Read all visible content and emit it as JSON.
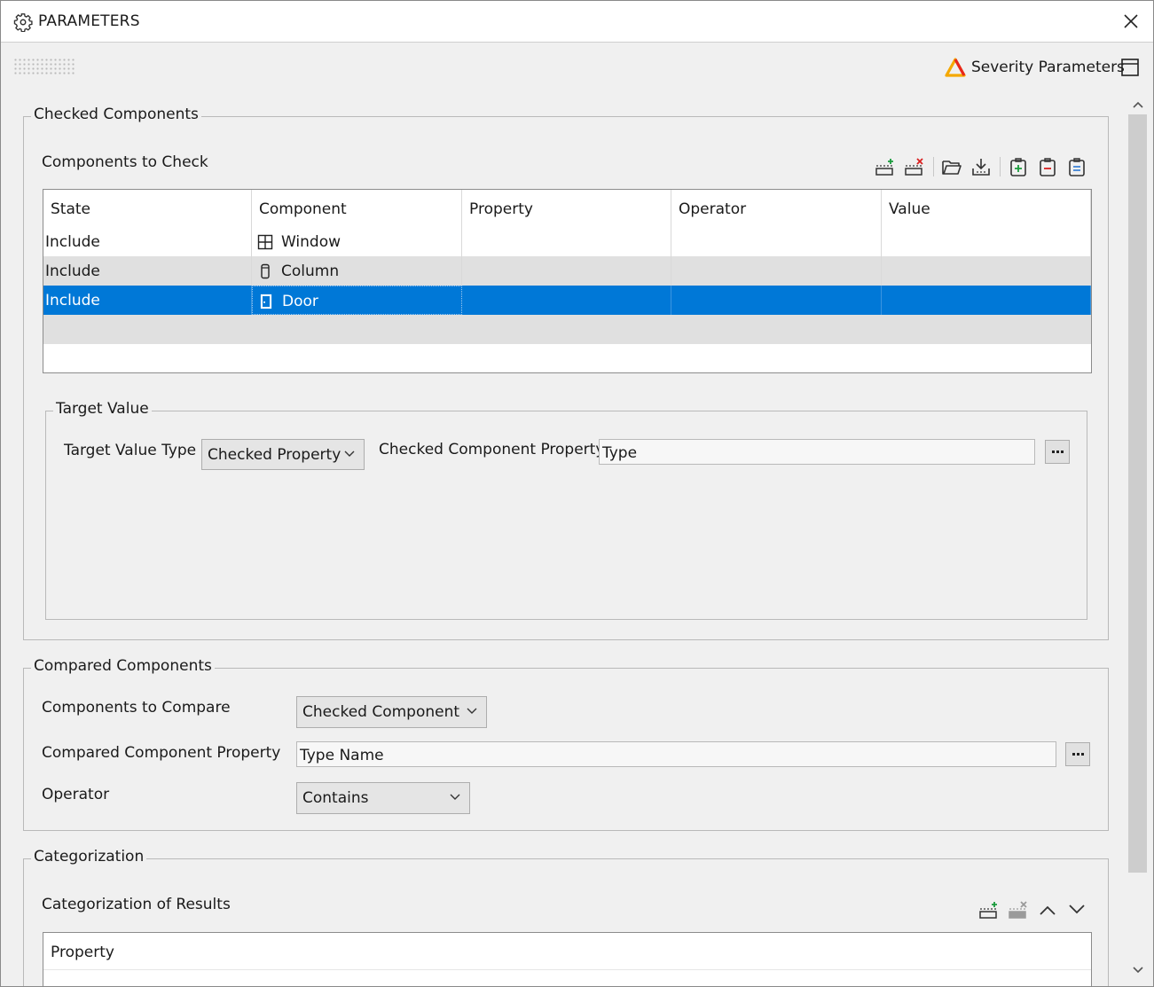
{
  "window": {
    "title": "PARAMETERS"
  },
  "header": {
    "severity_label": "Severity Parameters"
  },
  "checked": {
    "legend": "Checked Components",
    "components_label": "Components to Check",
    "columns": [
      "State",
      "Component",
      "Property",
      "Operator",
      "Value"
    ],
    "rows": [
      {
        "state": "Include",
        "component": "Window",
        "icon": "window-icon",
        "property": "",
        "operator": "",
        "value": ""
      },
      {
        "state": "Include",
        "component": "Column",
        "icon": "column-icon",
        "property": "",
        "operator": "",
        "value": ""
      },
      {
        "state": "Include",
        "component": "Door",
        "icon": "door-icon",
        "property": "",
        "operator": "",
        "value": "",
        "selected": true
      }
    ],
    "toolbar": [
      "add-row-icon",
      "remove-row-icon",
      "open-folder-icon",
      "download-icon",
      "add-item-icon",
      "remove-item-icon",
      "edit-item-icon"
    ]
  },
  "target": {
    "legend": "Target Value",
    "type_label": "Target Value Type",
    "type_value": "Checked Property",
    "property_label": "Checked Component Property",
    "property_value": "Type"
  },
  "compared": {
    "legend": "Compared Components",
    "components_label": "Components to Compare",
    "components_value": "Checked Component",
    "property_label": "Compared Component Property",
    "property_value": "Type Name",
    "operator_label": "Operator",
    "operator_value": "Contains"
  },
  "categorization": {
    "legend": "Categorization",
    "results_label": "Categorization of Results",
    "columns": [
      "Property"
    ],
    "toolbar": [
      "add-row-icon",
      "remove-row-icon",
      "move-up-icon",
      "move-down-icon"
    ]
  },
  "colors": {
    "selection": "#0078d7",
    "row_alt": "#e0e0e0",
    "background": "#f0f0f0"
  }
}
